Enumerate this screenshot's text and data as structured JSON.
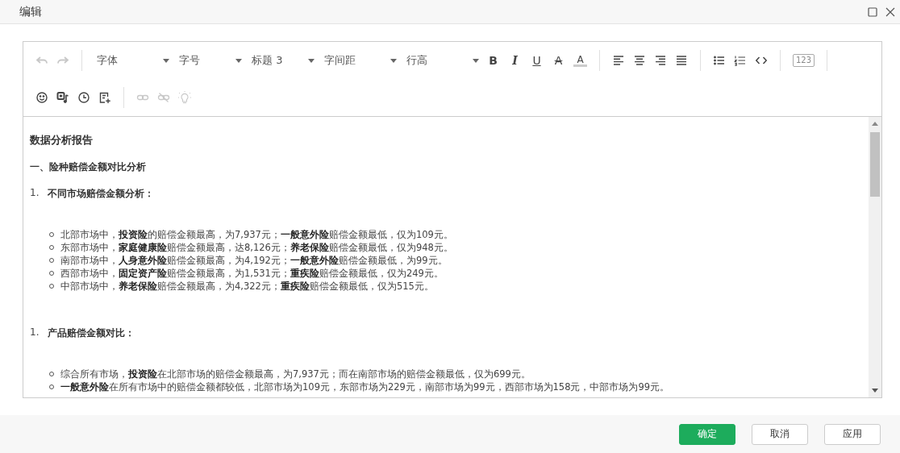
{
  "dialog": {
    "title": "编辑"
  },
  "toolbar": {
    "row_1": [
      {
        "kind": "icon",
        "disabled": true
      },
      {
        "kind": "icon",
        "disabled": true
      },
      {
        "kind": "separator"
      },
      {
        "kind": "dropdown",
        "label": "字体"
      },
      {
        "kind": "dropdown",
        "label": "字号"
      },
      {
        "kind": "dropdown",
        "label": "标题 3"
      },
      {
        "kind": "dropdown",
        "label": "字间距"
      },
      {
        "kind": "dropdown",
        "label": "行高"
      },
      {
        "kind": "glyph",
        "label": "B",
        "disabled": false
      },
      {
        "kind": "glyph",
        "label": "I",
        "disabled": false
      },
      {
        "kind": "glyph",
        "label": "U",
        "disabled": false
      },
      {
        "kind": "glyph",
        "label": "A",
        "disabled": false
      },
      {
        "kind": "glyph",
        "label": "A",
        "disabled": false
      },
      {
        "kind": "separator"
      },
      {
        "kind": "icon",
        "disabled": false
      },
      {
        "kind": "icon",
        "disabled": false
      },
      {
        "kind": "icon",
        "disabled": false
      },
      {
        "kind": "icon",
        "disabled": false
      },
      {
        "kind": "separator"
      },
      {
        "kind": "icon",
        "disabled": false
      },
      {
        "kind": "icon",
        "disabled": false
      },
      {
        "kind": "icon",
        "disabled": false
      },
      {
        "kind": "separator"
      },
      {
        "kind": "icon",
        "label": "123",
        "disabled": true
      },
      {
        "kind": "separator"
      }
    ],
    "row_2": [
      {
        "kind": "icon",
        "disabled": false
      },
      {
        "kind": "icon",
        "disabled": false
      },
      {
        "kind": "icon",
        "disabled": false
      },
      {
        "kind": "icon",
        "disabled": false
      },
      {
        "kind": "separator"
      },
      {
        "kind": "icon",
        "disabled": true
      },
      {
        "kind": "icon",
        "disabled": true
      },
      {
        "kind": "icon",
        "disabled": true
      }
    ]
  },
  "content": [
    {
      "kind": "title",
      "text": "数据分析报告"
    },
    {
      "kind": "heading",
      "text": "一、险种赔偿金额对比分析"
    },
    {
      "kind": "numbered",
      "number": "1.",
      "text": "不同市场赔偿金额分析："
    },
    {
      "kind": "bullets",
      "items": [
        "北部市场中，**投资险**的赔偿金额最高，为7,937元；**一般意外险**赔偿金额最低，仅为109元。",
        "东部市场中，**家庭健康险**赔偿金额最高，达8,126元；**养老保险**赔偿金额最低，仅为948元。",
        "南部市场中，**人身意外险**赔偿金额最高，为4,192元；**一般意外险**赔偿金额最低，为99元。",
        "西部市场中，**固定资产险**赔偿金额最高，为1,531元；**重疾险**赔偿金额最低，仅为249元。",
        "中部市场中，**养老保险**赔偿金额最高，为4,322元；**重疾险**赔偿金额最低，仅为515元。"
      ]
    },
    {
      "kind": "numbered",
      "number": "1.",
      "text": "产品赔偿金额对比："
    },
    {
      "kind": "bullets",
      "items": [
        "综合所有市场，**投资险**在北部市场的赔偿金额最高，为7,937元；而在南部市场的赔偿金额最低，仅为699元。",
        "**一般意外险**在所有市场中的赔偿金额都较低，北部市场为109元，东部市场为229元，南部市场为99元，西部市场为158元，中部市场为99元。"
      ]
    }
  ],
  "buttons": [
    {
      "label": "确定",
      "kind": "primary"
    },
    {
      "label": "取消",
      "kind": "default"
    },
    {
      "label": "应用",
      "kind": "default"
    }
  ]
}
